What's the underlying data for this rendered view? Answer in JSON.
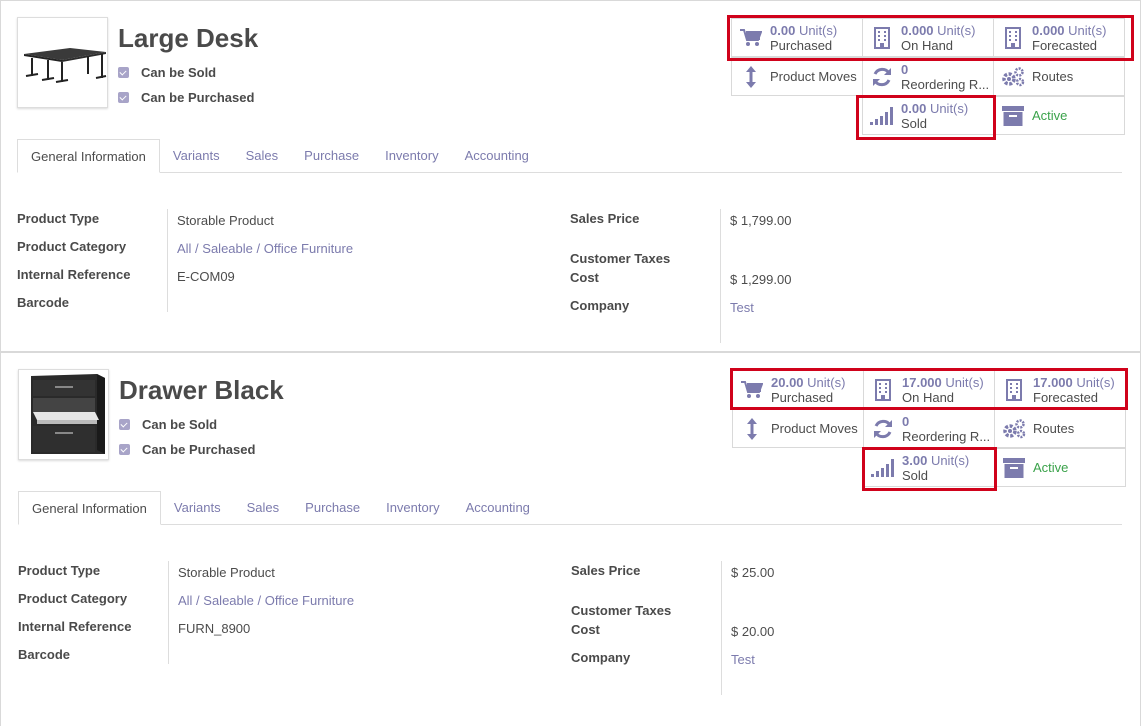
{
  "products": [
    {
      "name": "Large Desk",
      "can_be_sold": "Can be Sold",
      "can_be_purchased": "Can be Purchased",
      "stats": {
        "purchased": {
          "num": "0.00",
          "unit": "Unit(s)",
          "label": "Purchased"
        },
        "on_hand": {
          "num": "0.000",
          "unit": "Unit(s)",
          "label": "On Hand"
        },
        "forecasted": {
          "num": "0.000",
          "unit": "Unit(s)",
          "label": "Forecasted"
        },
        "product_moves": "Product Moves",
        "reordering": {
          "num": "0",
          "label": "Reordering R..."
        },
        "routes": "Routes",
        "sold": {
          "num": "0.00",
          "unit": "Unit(s)",
          "label": "Sold"
        },
        "active": "Active"
      },
      "tabs": [
        "General Information",
        "Variants",
        "Sales",
        "Purchase",
        "Inventory",
        "Accounting"
      ],
      "fields": {
        "product_type_label": "Product Type",
        "product_type": "Storable Product",
        "category_label": "Product Category",
        "category": "All / Saleable / Office Furniture",
        "internal_ref_label": "Internal Reference",
        "internal_ref": "E-COM09",
        "barcode_label": "Barcode",
        "sales_price_label": "Sales Price",
        "sales_price": "$ 1,799.00",
        "customer_taxes_label": "Customer Taxes",
        "cost_label": "Cost",
        "cost": "$ 1,299.00",
        "company_label": "Company",
        "company": "Test"
      }
    },
    {
      "name": "Drawer Black",
      "can_be_sold": "Can be Sold",
      "can_be_purchased": "Can be Purchased",
      "stats": {
        "purchased": {
          "num": "20.00",
          "unit": "Unit(s)",
          "label": "Purchased"
        },
        "on_hand": {
          "num": "17.000",
          "unit": "Unit(s)",
          "label": "On Hand"
        },
        "forecasted": {
          "num": "17.000",
          "unit": "Unit(s)",
          "label": "Forecasted"
        },
        "product_moves": "Product Moves",
        "reordering": {
          "num": "0",
          "label": "Reordering R..."
        },
        "routes": "Routes",
        "sold": {
          "num": "3.00",
          "unit": "Unit(s)",
          "label": "Sold"
        },
        "active": "Active"
      },
      "tabs": [
        "General Information",
        "Variants",
        "Sales",
        "Purchase",
        "Inventory",
        "Accounting"
      ],
      "fields": {
        "product_type_label": "Product Type",
        "product_type": "Storable Product",
        "category_label": "Product Category",
        "category": "All / Saleable / Office Furniture",
        "internal_ref_label": "Internal Reference",
        "internal_ref": "FURN_8900",
        "barcode_label": "Barcode",
        "sales_price_label": "Sales Price",
        "sales_price": "$ 25.00",
        "customer_taxes_label": "Customer Taxes",
        "cost_label": "Cost",
        "cost": "$ 20.00",
        "company_label": "Company",
        "company": "Test"
      }
    }
  ],
  "colors": {
    "accent": "#7c7bad",
    "highlight": "#d0021b",
    "active": "#3aa24a"
  }
}
